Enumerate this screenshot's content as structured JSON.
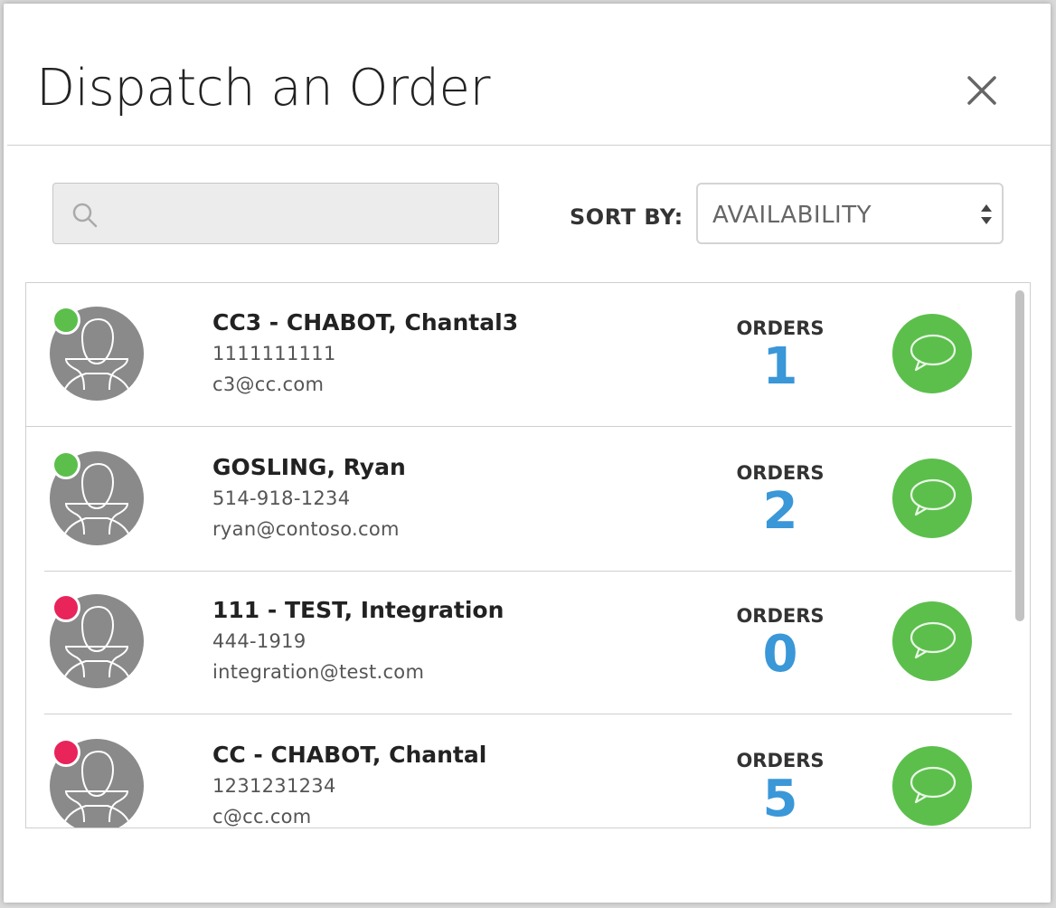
{
  "dialog": {
    "title": "Dispatch an Order",
    "close_icon": "close-icon"
  },
  "search": {
    "value": "",
    "placeholder": "",
    "icon": "search-icon"
  },
  "sort": {
    "label": "SORT BY:",
    "selected": "AVAILABILITY"
  },
  "status_colors": {
    "available": "#5cbf4c",
    "unavailable": "#e8245a"
  },
  "accent_colors": {
    "orders_count": "#3a97d8",
    "chat_button": "#5cbf4c"
  },
  "drivers": [
    {
      "name": "CC3 - CHABOT, Chantal3",
      "phone": "1111111111",
      "email": "c3@cc.com",
      "status": "available",
      "orders_label": "ORDERS",
      "orders_count": "1"
    },
    {
      "name": "GOSLING, Ryan",
      "phone": "514-918-1234",
      "email": "ryan@contoso.com",
      "status": "available",
      "orders_label": "ORDERS",
      "orders_count": "2"
    },
    {
      "name": "111 - TEST, Integration",
      "phone": "444-1919",
      "email": "integration@test.com",
      "status": "unavailable",
      "orders_label": "ORDERS",
      "orders_count": "0"
    },
    {
      "name": "CC - CHABOT, Chantal",
      "phone": "1231231234",
      "email": "c@cc.com",
      "status": "unavailable",
      "orders_label": "ORDERS",
      "orders_count": "5"
    }
  ]
}
